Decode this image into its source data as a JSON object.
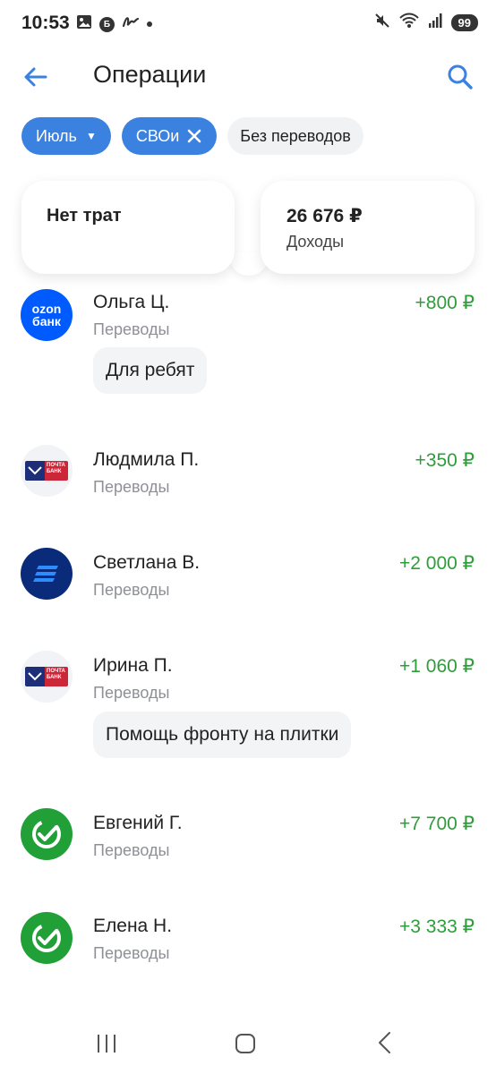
{
  "status_bar": {
    "time": "10:53",
    "notif_b": "Б",
    "battery": "99",
    "icons": [
      "image-icon",
      "b-badge-icon",
      "signature-icon",
      "dot-icon",
      "mute-icon",
      "wifi-icon",
      "signal-icon",
      "battery-icon"
    ]
  },
  "header": {
    "title": "Операции"
  },
  "filters": [
    {
      "label": "Июль",
      "active": true,
      "icon": "chevron-down-icon"
    },
    {
      "label": "СВОи",
      "active": true,
      "icon": "close-icon"
    },
    {
      "label": "Без переводов",
      "active": false
    }
  ],
  "summary": {
    "expenses_label": "Нет трат",
    "income_amount": "26 676 ₽",
    "income_label": "Доходы"
  },
  "operations": [
    {
      "name": "Ольга Ц.",
      "category": "Переводы",
      "amount": "+800 ₽",
      "note": "Для ребят",
      "logo": "ozon-bank-logo",
      "logo_text_1": "ozon",
      "logo_text_2": "банк"
    },
    {
      "name": "Людмила П.",
      "category": "Переводы",
      "amount": "+350 ₽",
      "logo": "pochta-bank-logo",
      "logo_text": "ПОЧТА БАНК"
    },
    {
      "name": "Светлана В.",
      "category": "Переводы",
      "amount": "+2 000 ₽",
      "logo": "sovcombank-logo"
    },
    {
      "name": "Ирина П.",
      "category": "Переводы",
      "amount": "+1 060 ₽",
      "note": "Помощь фронту на плитки",
      "logo": "pochta-bank-logo",
      "logo_text": "ПОЧТА БАНК"
    },
    {
      "name": "Евгений Г.",
      "category": "Переводы",
      "amount": "+7 700 ₽",
      "logo": "sber-logo"
    },
    {
      "name": "Елена Н.",
      "category": "Переводы",
      "amount": "+3 333 ₽",
      "logo": "sber-logo"
    }
  ],
  "colors": {
    "accent": "#3b82e0",
    "income_green": "#2e9d3a",
    "muted_text": "#8e9096",
    "ozon_blue": "#005bff",
    "sber_green": "#21a038",
    "pochta_red": "#cc2639",
    "pochta_blue": "#1d2f78"
  },
  "nav": [
    "recents-button",
    "home-button",
    "back-button"
  ]
}
